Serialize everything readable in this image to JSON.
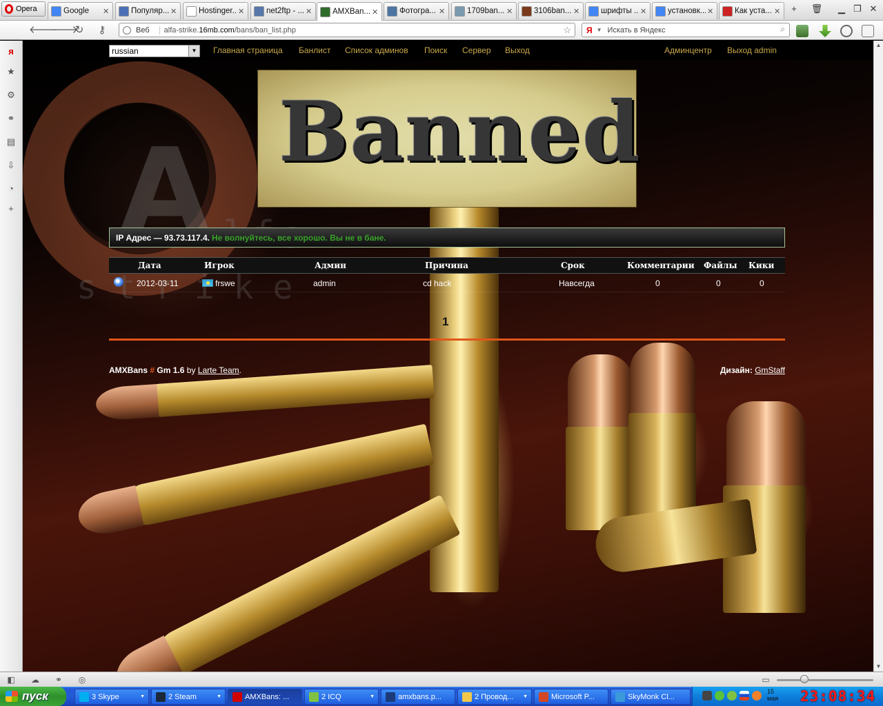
{
  "browser": {
    "menu_label": "Opera",
    "tabs": [
      {
        "label": "Google",
        "color": "#4285f4"
      },
      {
        "label": "Популяр...",
        "color": "#4a6fb5"
      },
      {
        "label": "Hostinger...",
        "color": "#ffffff"
      },
      {
        "label": "net2ftp - ...",
        "color": "#5577aa"
      },
      {
        "label": "AMXBan...",
        "color": "#2f6b2a"
      },
      {
        "label": "Фотогра...",
        "color": "#4c75a3"
      },
      {
        "label": "1709ban...",
        "color": "#7a9ab0"
      },
      {
        "label": "3106ban....",
        "color": "#7a3a1a"
      },
      {
        "label": "шрифты ...",
        "color": "#4285f4"
      },
      {
        "label": "установк...",
        "color": "#4285f4"
      },
      {
        "label": "Как уста...",
        "color": "#cc2222"
      }
    ],
    "address": {
      "badge": "Веб",
      "url_prefix": "alfa-strike.",
      "url_host": "16mb.com",
      "url_path": "/bans/ban_list.php"
    },
    "search": {
      "engine": "Я",
      "placeholder": "Искать в Яндекс"
    }
  },
  "site": {
    "language": "russian",
    "nav_left": [
      "Главная страница",
      "Банлист",
      "Список админов",
      "Поиск",
      "Сервер",
      "Выход"
    ],
    "nav_right": [
      "Админцентр",
      "Выход admin"
    ],
    "banner_text": "Banned",
    "ip_label": "IP Адрес — 93.73.117.4.",
    "ip_status": "Не волнуйтесь, все хорошо. Вы не в бане.",
    "table": {
      "headers": [
        "Дата",
        "Игрок",
        "Админ",
        "Причина",
        "Срок",
        "Комментарии",
        "Файлы",
        "Кики"
      ],
      "rows": [
        {
          "date": "2012-03-11",
          "player": "frswe",
          "admin": "admin",
          "reason": "cd hack",
          "term": "Навсегда",
          "comments": "0",
          "files": "0",
          "kicks": "0"
        }
      ]
    },
    "pager": "1",
    "footer": {
      "app": "AMXBans",
      "hash": "#",
      "version": "Gm 1.6",
      "by": "by",
      "team": "Larte Team",
      "design_label": "Дизайн",
      "design_by": "GmStaff"
    },
    "accent_color": "#e0561a",
    "ok_color": "#3aa12a"
  },
  "taskbar": {
    "start_label": "пуск",
    "tasks": [
      {
        "count": "3",
        "label": "Skype",
        "color": "#00aff0"
      },
      {
        "count": "2",
        "label": "Steam",
        "color": "#1b2838"
      },
      {
        "count": "",
        "label": "AMXBans: ...",
        "color": "#d00000"
      },
      {
        "count": "2",
        "label": "ICQ",
        "color": "#7fc243"
      },
      {
        "count": "",
        "label": "amxbans.p...",
        "color": "#1c3a7a"
      },
      {
        "count": "2",
        "label": "Провод...",
        "color": "#f2c84b"
      },
      {
        "count": "",
        "label": "Microsoft P...",
        "color": "#d24726"
      },
      {
        "count": "",
        "label": "SkyMonk Cl...",
        "color": "#3a9ad9"
      }
    ],
    "date_day": "15",
    "date_month": "мая",
    "clock": "23:08:34"
  }
}
